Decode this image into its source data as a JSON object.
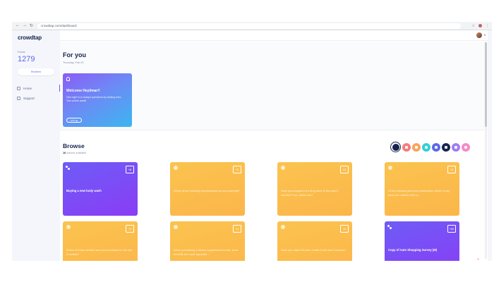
{
  "browser": {
    "url": "crowdtap.com/dashboard"
  },
  "sidebar": {
    "logo": "crowdtap",
    "points_label": "Points",
    "points_value": "1279",
    "redeem_label": "Redeem",
    "items": [
      {
        "label": "Home",
        "icon": "home-icon"
      },
      {
        "label": "Support",
        "icon": "support-icon"
      }
    ]
  },
  "for_you": {
    "title": "For you",
    "date": "Thursday, Feb 02",
    "welcome": {
      "title": "Welcome Heyilmar!!",
      "text": "Dive right in to today's questions by clicking here. Your points await!",
      "button": "Let's go"
    }
  },
  "browse": {
    "title": "Browse",
    "count_number": "16",
    "count_text": "actions available",
    "filters": [
      {
        "name": "all",
        "color": "#16234d"
      },
      {
        "name": "red",
        "color": "#f47c7c"
      },
      {
        "name": "orange",
        "color": "#f9a55a"
      },
      {
        "name": "teal",
        "color": "#2fd0d5"
      },
      {
        "name": "indigo",
        "color": "#5b68e8"
      },
      {
        "name": "navy",
        "color": "#16234d"
      },
      {
        "name": "violet",
        "color": "#a07cf5"
      },
      {
        "name": "pink",
        "color": "#f58ac5"
      }
    ],
    "cards": [
      {
        "style": "purple",
        "badge": "+8",
        "text": "Buying a new body wash"
      },
      {
        "style": "orange",
        "badge": "+2",
        "text": "Which of the following mouthwashes do you currently?"
      },
      {
        "style": "orange",
        "badge": "+2",
        "text": "Have you shopped at a drug store in the past 6 months? If so, which one?"
      },
      {
        "style": "orange",
        "badge": "+2",
        "text": "Of the following fast food restaurants, which, if any, have you visited in the p..."
      },
      {
        "style": "orange",
        "badge": "+2",
        "text": "Which of these cereals have you purchased in the last 6 months?"
      },
      {
        "style": "orange",
        "badge": "+2",
        "text": "When purchasing a dietary supplement for hair, what benefits are most important ..."
      },
      {
        "style": "orange",
        "badge": "+2",
        "text": "Have you visited Dunkin' Coffee in the last 3 months?"
      },
      {
        "style": "purple",
        "badge": "+60",
        "text": "Copy of Auto Shopping Survey (M)"
      }
    ]
  }
}
